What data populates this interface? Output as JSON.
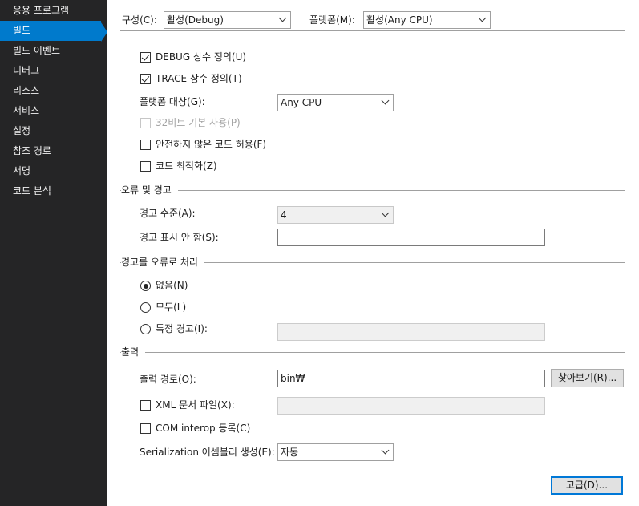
{
  "sidebar": {
    "items": [
      {
        "label": "응용 프로그램",
        "selected": false
      },
      {
        "label": "빌드",
        "selected": true
      },
      {
        "label": "빌드 이벤트",
        "selected": false
      },
      {
        "label": "디버그",
        "selected": false
      },
      {
        "label": "리소스",
        "selected": false
      },
      {
        "label": "서비스",
        "selected": false
      },
      {
        "label": "설정",
        "selected": false
      },
      {
        "label": "참조 경로",
        "selected": false
      },
      {
        "label": "서명",
        "selected": false
      },
      {
        "label": "코드 분석",
        "selected": false
      }
    ]
  },
  "config": {
    "configuration_label": "구성(C):",
    "configuration_value": "활성(Debug)",
    "platform_label": "플랫폼(M):",
    "platform_value": "활성(Any CPU)"
  },
  "general": {
    "debug_const": {
      "label": "DEBUG 상수 정의(U)",
      "checked": true
    },
    "trace_const": {
      "label": "TRACE 상수 정의(T)",
      "checked": true
    },
    "platform_target_label": "플랫폼 대상(G):",
    "platform_target_value": "Any CPU",
    "prefer32": {
      "label": "32비트 기본 사용(P)",
      "checked": false,
      "disabled": true
    },
    "unsafe": {
      "label": "안전하지 않은 코드 허용(F)",
      "checked": false
    },
    "optimize": {
      "label": "코드 최적화(Z)",
      "checked": false
    }
  },
  "errors": {
    "title": "오류 및 경고",
    "warning_level_label": "경고 수준(A):",
    "warning_level_value": "4",
    "suppress_label": "경고 표시 안 함(S):",
    "suppress_value": ""
  },
  "treat_warnings": {
    "title": "경고를 오류로 처리",
    "options": [
      {
        "label": "없음(N)",
        "selected": true
      },
      {
        "label": "모두(L)",
        "selected": false
      },
      {
        "label": "특정 경고(I):",
        "selected": false
      }
    ],
    "specific_value": ""
  },
  "output": {
    "title": "출력",
    "path_label": "출력 경로(O):",
    "path_value": "bin₩",
    "browse_label": "찾아보기(R)...",
    "xml_doc": {
      "label": "XML 문서 파일(X):",
      "checked": false
    },
    "xml_value": "",
    "com_interop": {
      "label": "COM interop 등록(C)",
      "checked": false
    },
    "serialization_label": "Serialization 어셈블리 생성(E):",
    "serialization_value": "자동"
  },
  "advanced_label": "고급(D)...",
  "colors": {
    "sidebar_bg": "#252526",
    "selected_bg": "#007acc",
    "sidebar_text": "#f1f1f1"
  }
}
